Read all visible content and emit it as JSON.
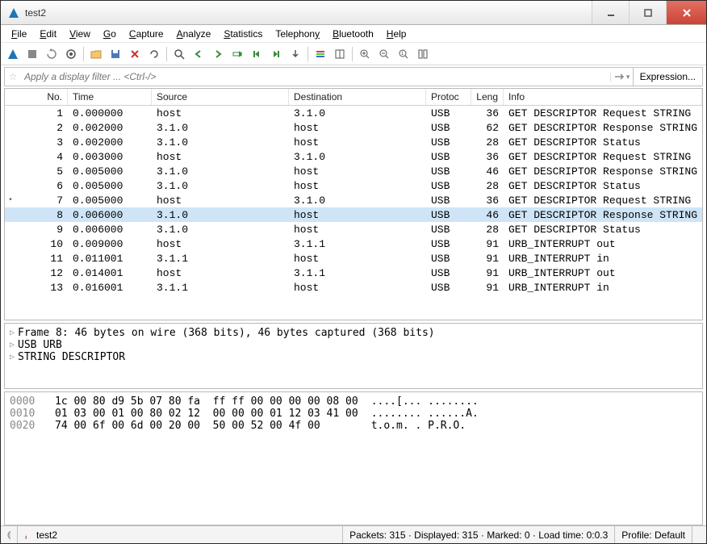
{
  "window": {
    "title": "test2"
  },
  "menus": [
    "File",
    "Edit",
    "View",
    "Go",
    "Capture",
    "Analyze",
    "Statistics",
    "Telephony",
    "Bluetooth",
    "Help"
  ],
  "filter": {
    "placeholder": "Apply a display filter ... <Ctrl-/>",
    "expression_label": "Expression..."
  },
  "columns": {
    "no": "No.",
    "time": "Time",
    "source": "Source",
    "destination": "Destination",
    "protocol": "Protoc",
    "length": "Leng",
    "info": "Info"
  },
  "packets": [
    {
      "no": "1",
      "time": "0.000000",
      "src": "host",
      "dst": "3.1.0",
      "proto": "USB",
      "len": "36",
      "info": "GET DESCRIPTOR Request STRING",
      "marked": false,
      "selected": false
    },
    {
      "no": "2",
      "time": "0.002000",
      "src": "3.1.0",
      "dst": "host",
      "proto": "USB",
      "len": "62",
      "info": "GET DESCRIPTOR Response STRING",
      "marked": false,
      "selected": false
    },
    {
      "no": "3",
      "time": "0.002000",
      "src": "3.1.0",
      "dst": "host",
      "proto": "USB",
      "len": "28",
      "info": "GET DESCRIPTOR Status",
      "marked": false,
      "selected": false
    },
    {
      "no": "4",
      "time": "0.003000",
      "src": "host",
      "dst": "3.1.0",
      "proto": "USB",
      "len": "36",
      "info": "GET DESCRIPTOR Request STRING",
      "marked": false,
      "selected": false
    },
    {
      "no": "5",
      "time": "0.005000",
      "src": "3.1.0",
      "dst": "host",
      "proto": "USB",
      "len": "46",
      "info": "GET DESCRIPTOR Response STRING",
      "marked": false,
      "selected": false
    },
    {
      "no": "6",
      "time": "0.005000",
      "src": "3.1.0",
      "dst": "host",
      "proto": "USB",
      "len": "28",
      "info": "GET DESCRIPTOR Status",
      "marked": false,
      "selected": false
    },
    {
      "no": "7",
      "time": "0.005000",
      "src": "host",
      "dst": "3.1.0",
      "proto": "USB",
      "len": "36",
      "info": "GET DESCRIPTOR Request STRING",
      "marked": true,
      "selected": false
    },
    {
      "no": "8",
      "time": "0.006000",
      "src": "3.1.0",
      "dst": "host",
      "proto": "USB",
      "len": "46",
      "info": "GET DESCRIPTOR Response STRING",
      "marked": false,
      "selected": true
    },
    {
      "no": "9",
      "time": "0.006000",
      "src": "3.1.0",
      "dst": "host",
      "proto": "USB",
      "len": "28",
      "info": "GET DESCRIPTOR Status",
      "marked": false,
      "selected": false
    },
    {
      "no": "10",
      "time": "0.009000",
      "src": "host",
      "dst": "3.1.1",
      "proto": "USB",
      "len": "91",
      "info": "URB_INTERRUPT out",
      "marked": false,
      "selected": false
    },
    {
      "no": "11",
      "time": "0.011001",
      "src": "3.1.1",
      "dst": "host",
      "proto": "USB",
      "len": "91",
      "info": "URB_INTERRUPT in",
      "marked": false,
      "selected": false
    },
    {
      "no": "12",
      "time": "0.014001",
      "src": "host",
      "dst": "3.1.1",
      "proto": "USB",
      "len": "91",
      "info": "URB_INTERRUPT out",
      "marked": false,
      "selected": false
    },
    {
      "no": "13",
      "time": "0.016001",
      "src": "3.1.1",
      "dst": "host",
      "proto": "USB",
      "len": "91",
      "info": "URB_INTERRUPT in",
      "marked": false,
      "selected": false
    }
  ],
  "detail": {
    "lines": [
      "Frame 8: 46 bytes on wire (368 bits), 46 bytes captured (368 bits)",
      "USB URB",
      "STRING DESCRIPTOR"
    ]
  },
  "hex": {
    "rows": [
      {
        "off": "0000",
        "bytes": "1c 00 80 d9 5b 07 80 fa  ff ff 00 00 00 00 08 00",
        "ascii": "....[... ........"
      },
      {
        "off": "0010",
        "bytes": "01 03 00 01 00 80 02 12  00 00 00 01 12 03 41 00",
        "ascii": "........ ......A."
      },
      {
        "off": "0020",
        "bytes": "74 00 6f 00 6d 00 20 00  50 00 52 00 4f 00      ",
        "ascii": "t.o.m. . P.R.O."
      }
    ]
  },
  "status": {
    "file": "test2",
    "stats": "Packets: 315 · Displayed: 315 · Marked: 0 · Load time: 0:0.3",
    "profile": "Profile: Default"
  }
}
